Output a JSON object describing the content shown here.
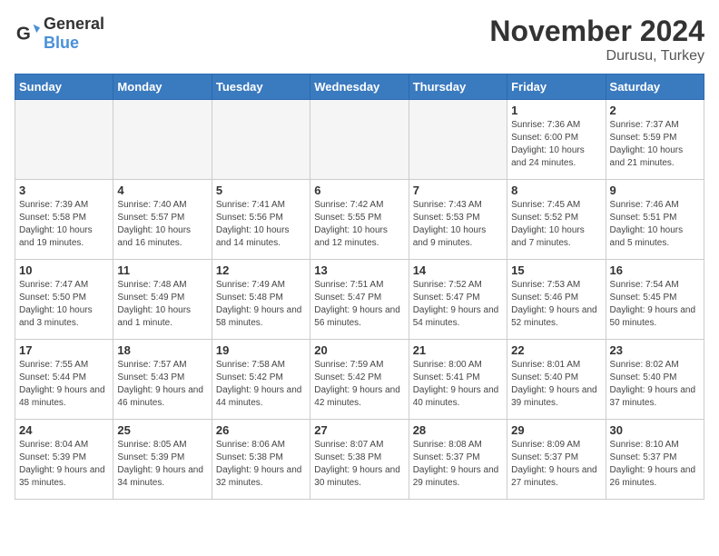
{
  "logo": {
    "general": "General",
    "blue": "Blue"
  },
  "header": {
    "month": "November 2024",
    "location": "Durusu, Turkey"
  },
  "days_of_week": [
    "Sunday",
    "Monday",
    "Tuesday",
    "Wednesday",
    "Thursday",
    "Friday",
    "Saturday"
  ],
  "weeks": [
    [
      {
        "day": "",
        "info": ""
      },
      {
        "day": "",
        "info": ""
      },
      {
        "day": "",
        "info": ""
      },
      {
        "day": "",
        "info": ""
      },
      {
        "day": "",
        "info": ""
      },
      {
        "day": "1",
        "info": "Sunrise: 7:36 AM\nSunset: 6:00 PM\nDaylight: 10 hours and 24 minutes."
      },
      {
        "day": "2",
        "info": "Sunrise: 7:37 AM\nSunset: 5:59 PM\nDaylight: 10 hours and 21 minutes."
      }
    ],
    [
      {
        "day": "3",
        "info": "Sunrise: 7:39 AM\nSunset: 5:58 PM\nDaylight: 10 hours and 19 minutes."
      },
      {
        "day": "4",
        "info": "Sunrise: 7:40 AM\nSunset: 5:57 PM\nDaylight: 10 hours and 16 minutes."
      },
      {
        "day": "5",
        "info": "Sunrise: 7:41 AM\nSunset: 5:56 PM\nDaylight: 10 hours and 14 minutes."
      },
      {
        "day": "6",
        "info": "Sunrise: 7:42 AM\nSunset: 5:55 PM\nDaylight: 10 hours and 12 minutes."
      },
      {
        "day": "7",
        "info": "Sunrise: 7:43 AM\nSunset: 5:53 PM\nDaylight: 10 hours and 9 minutes."
      },
      {
        "day": "8",
        "info": "Sunrise: 7:45 AM\nSunset: 5:52 PM\nDaylight: 10 hours and 7 minutes."
      },
      {
        "day": "9",
        "info": "Sunrise: 7:46 AM\nSunset: 5:51 PM\nDaylight: 10 hours and 5 minutes."
      }
    ],
    [
      {
        "day": "10",
        "info": "Sunrise: 7:47 AM\nSunset: 5:50 PM\nDaylight: 10 hours and 3 minutes."
      },
      {
        "day": "11",
        "info": "Sunrise: 7:48 AM\nSunset: 5:49 PM\nDaylight: 10 hours and 1 minute."
      },
      {
        "day": "12",
        "info": "Sunrise: 7:49 AM\nSunset: 5:48 PM\nDaylight: 9 hours and 58 minutes."
      },
      {
        "day": "13",
        "info": "Sunrise: 7:51 AM\nSunset: 5:47 PM\nDaylight: 9 hours and 56 minutes."
      },
      {
        "day": "14",
        "info": "Sunrise: 7:52 AM\nSunset: 5:47 PM\nDaylight: 9 hours and 54 minutes."
      },
      {
        "day": "15",
        "info": "Sunrise: 7:53 AM\nSunset: 5:46 PM\nDaylight: 9 hours and 52 minutes."
      },
      {
        "day": "16",
        "info": "Sunrise: 7:54 AM\nSunset: 5:45 PM\nDaylight: 9 hours and 50 minutes."
      }
    ],
    [
      {
        "day": "17",
        "info": "Sunrise: 7:55 AM\nSunset: 5:44 PM\nDaylight: 9 hours and 48 minutes."
      },
      {
        "day": "18",
        "info": "Sunrise: 7:57 AM\nSunset: 5:43 PM\nDaylight: 9 hours and 46 minutes."
      },
      {
        "day": "19",
        "info": "Sunrise: 7:58 AM\nSunset: 5:42 PM\nDaylight: 9 hours and 44 minutes."
      },
      {
        "day": "20",
        "info": "Sunrise: 7:59 AM\nSunset: 5:42 PM\nDaylight: 9 hours and 42 minutes."
      },
      {
        "day": "21",
        "info": "Sunrise: 8:00 AM\nSunset: 5:41 PM\nDaylight: 9 hours and 40 minutes."
      },
      {
        "day": "22",
        "info": "Sunrise: 8:01 AM\nSunset: 5:40 PM\nDaylight: 9 hours and 39 minutes."
      },
      {
        "day": "23",
        "info": "Sunrise: 8:02 AM\nSunset: 5:40 PM\nDaylight: 9 hours and 37 minutes."
      }
    ],
    [
      {
        "day": "24",
        "info": "Sunrise: 8:04 AM\nSunset: 5:39 PM\nDaylight: 9 hours and 35 minutes."
      },
      {
        "day": "25",
        "info": "Sunrise: 8:05 AM\nSunset: 5:39 PM\nDaylight: 9 hours and 34 minutes."
      },
      {
        "day": "26",
        "info": "Sunrise: 8:06 AM\nSunset: 5:38 PM\nDaylight: 9 hours and 32 minutes."
      },
      {
        "day": "27",
        "info": "Sunrise: 8:07 AM\nSunset: 5:38 PM\nDaylight: 9 hours and 30 minutes."
      },
      {
        "day": "28",
        "info": "Sunrise: 8:08 AM\nSunset: 5:37 PM\nDaylight: 9 hours and 29 minutes."
      },
      {
        "day": "29",
        "info": "Sunrise: 8:09 AM\nSunset: 5:37 PM\nDaylight: 9 hours and 27 minutes."
      },
      {
        "day": "30",
        "info": "Sunrise: 8:10 AM\nSunset: 5:37 PM\nDaylight: 9 hours and 26 minutes."
      }
    ]
  ]
}
